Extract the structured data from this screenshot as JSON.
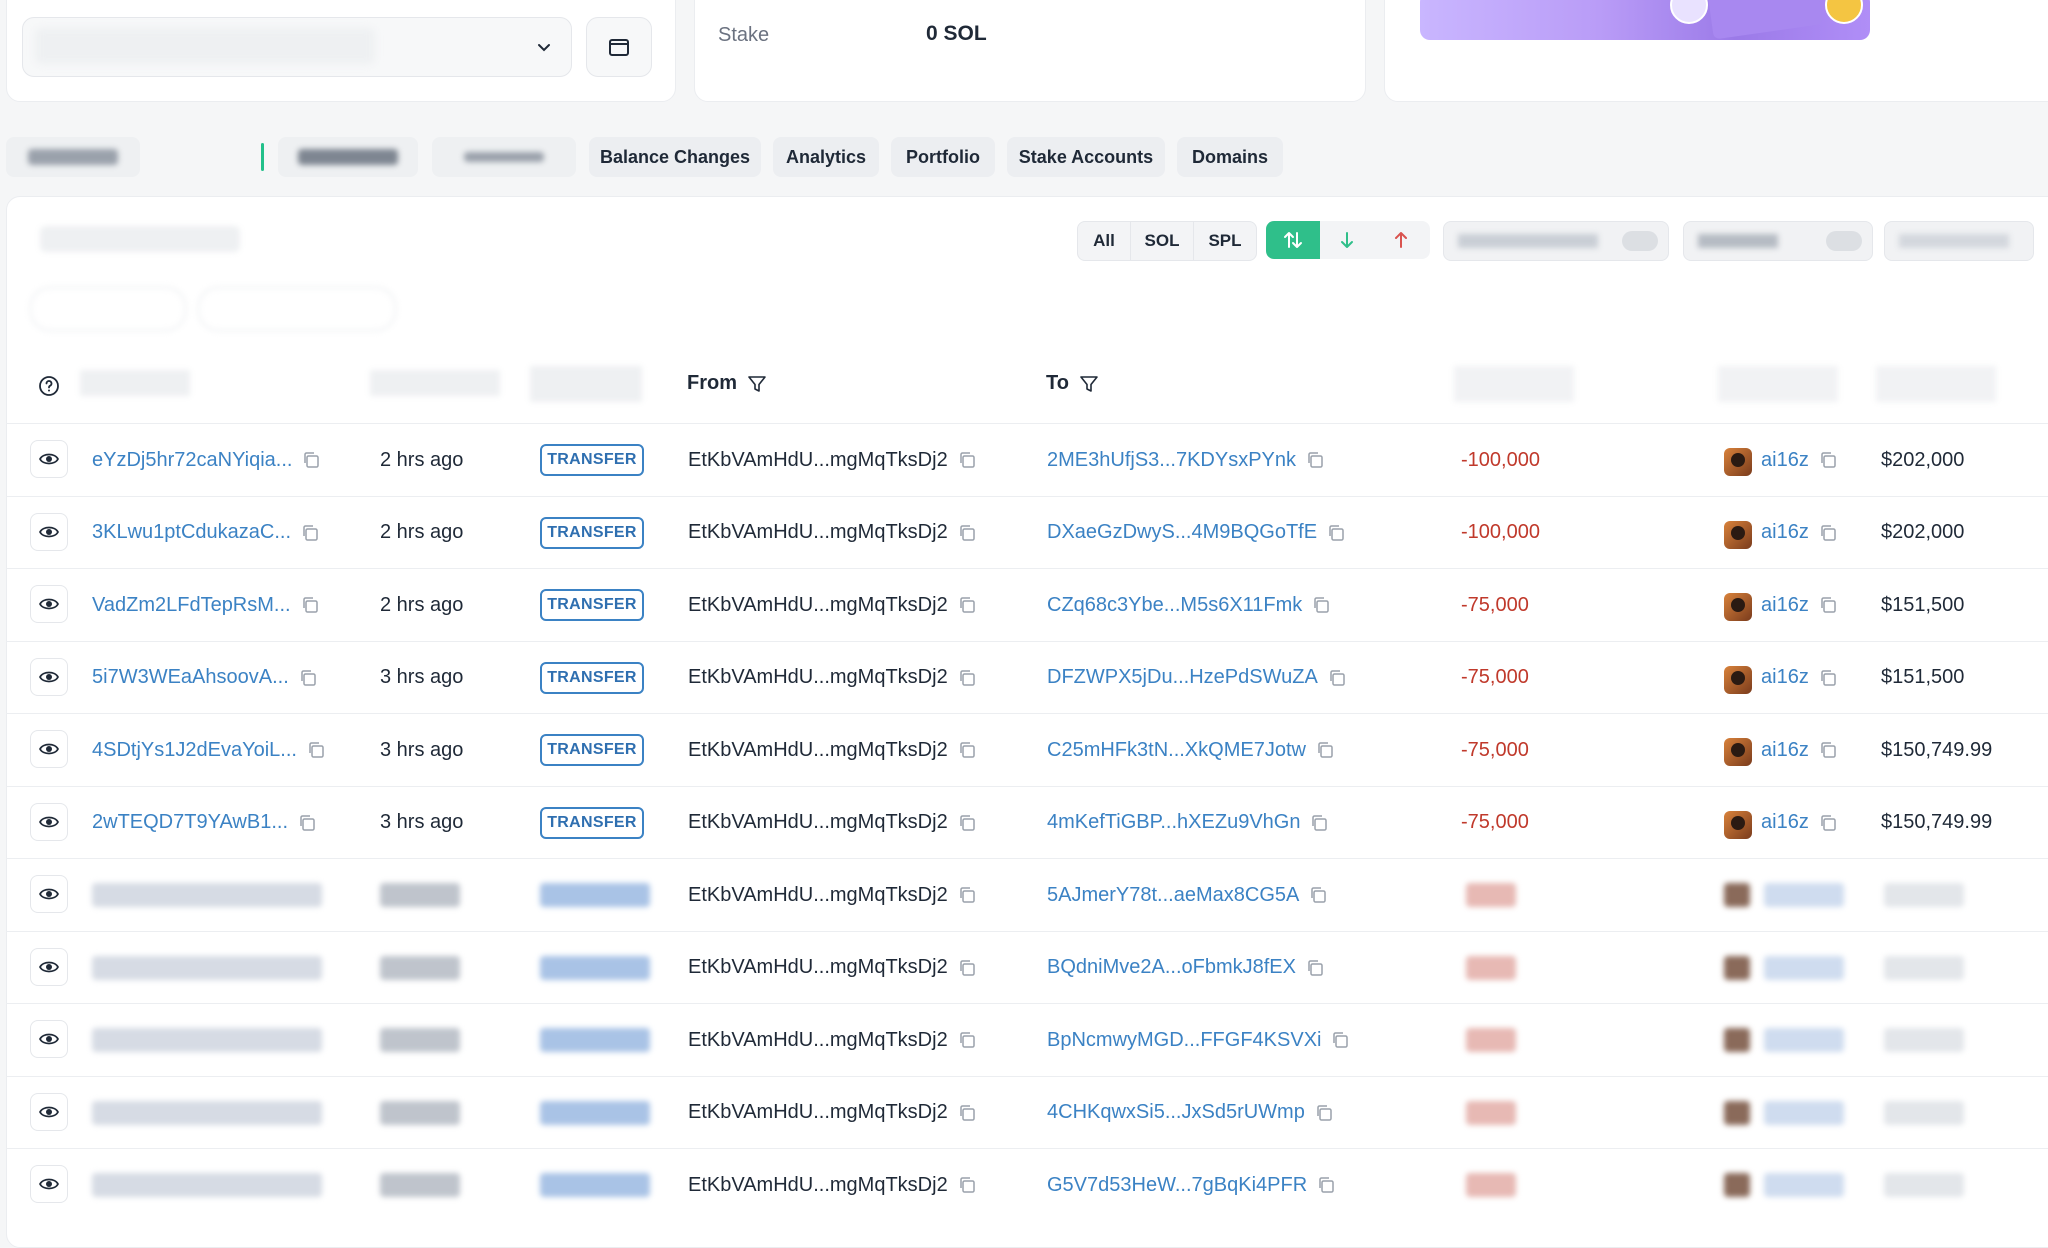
{
  "overview": {
    "stake_label": "Stake",
    "stake_value": "0 SOL"
  },
  "tabs": [
    "Balance Changes",
    "Analytics",
    "Portfolio",
    "Stake Accounts",
    "Domains"
  ],
  "filters": {
    "token_types": [
      "All",
      "SOL",
      "SPL"
    ],
    "sort_icons": [
      "sort-both-icon",
      "arrow-down-icon",
      "arrow-up-icon"
    ]
  },
  "table": {
    "headers": {
      "from": "From",
      "to": "To"
    },
    "badge_text": "TRANSFER",
    "from_address": "EtKbVAmHdU...mgMqTksDj2",
    "token_name": "ai16z",
    "rows": [
      {
        "sig": "eYzDj5hr72caNYiqia...",
        "time": "2 hrs ago",
        "to": "2ME3hUfjS3...7KDYsxPYnk",
        "amount": "-100,000",
        "value": "$202,000"
      },
      {
        "sig": "3KLwu1ptCdukazaC...",
        "time": "2 hrs ago",
        "to": "DXaeGzDwyS...4M9BQGoTfE",
        "amount": "-100,000",
        "value": "$202,000"
      },
      {
        "sig": "VadZm2LFdTepRsM...",
        "time": "2 hrs ago",
        "to": "CZq68c3Ybe...M5s6X11Fmk",
        "amount": "-75,000",
        "value": "$151,500"
      },
      {
        "sig": "5i7W3WEaAhsoovA...",
        "time": "3 hrs ago",
        "to": "DFZWPX5jDu...HzePdSWuZA",
        "amount": "-75,000",
        "value": "$151,500"
      },
      {
        "sig": "4SDtjYs1J2dEvaYoiL...",
        "time": "3 hrs ago",
        "to": "C25mHFk3tN...XkQME7Jotw",
        "amount": "-75,000",
        "value": "$150,749.99"
      },
      {
        "sig": "2wTEQD7T9YAwB1...",
        "time": "3 hrs ago",
        "to": "4mKefTiGBP...hXEZu9VhGn",
        "amount": "-75,000",
        "value": "$150,749.99"
      },
      {
        "to": "5AJmerY78t...aeMax8CG5A"
      },
      {
        "to": "BQdniMve2A...oFbmkJ8fEX"
      },
      {
        "to": "BpNcmwyMGD...FFGF4KSVXi"
      },
      {
        "to": "4CHKqwxSi5...JxSd5rUWmp"
      },
      {
        "to": "G5V7d53HeW...7gBqKi4PFR"
      }
    ]
  },
  "colors": {
    "link": "#3b82c4",
    "negative": "#c0392b",
    "accent_green": "#2fbf8a",
    "badge_border": "#3b82c4"
  }
}
